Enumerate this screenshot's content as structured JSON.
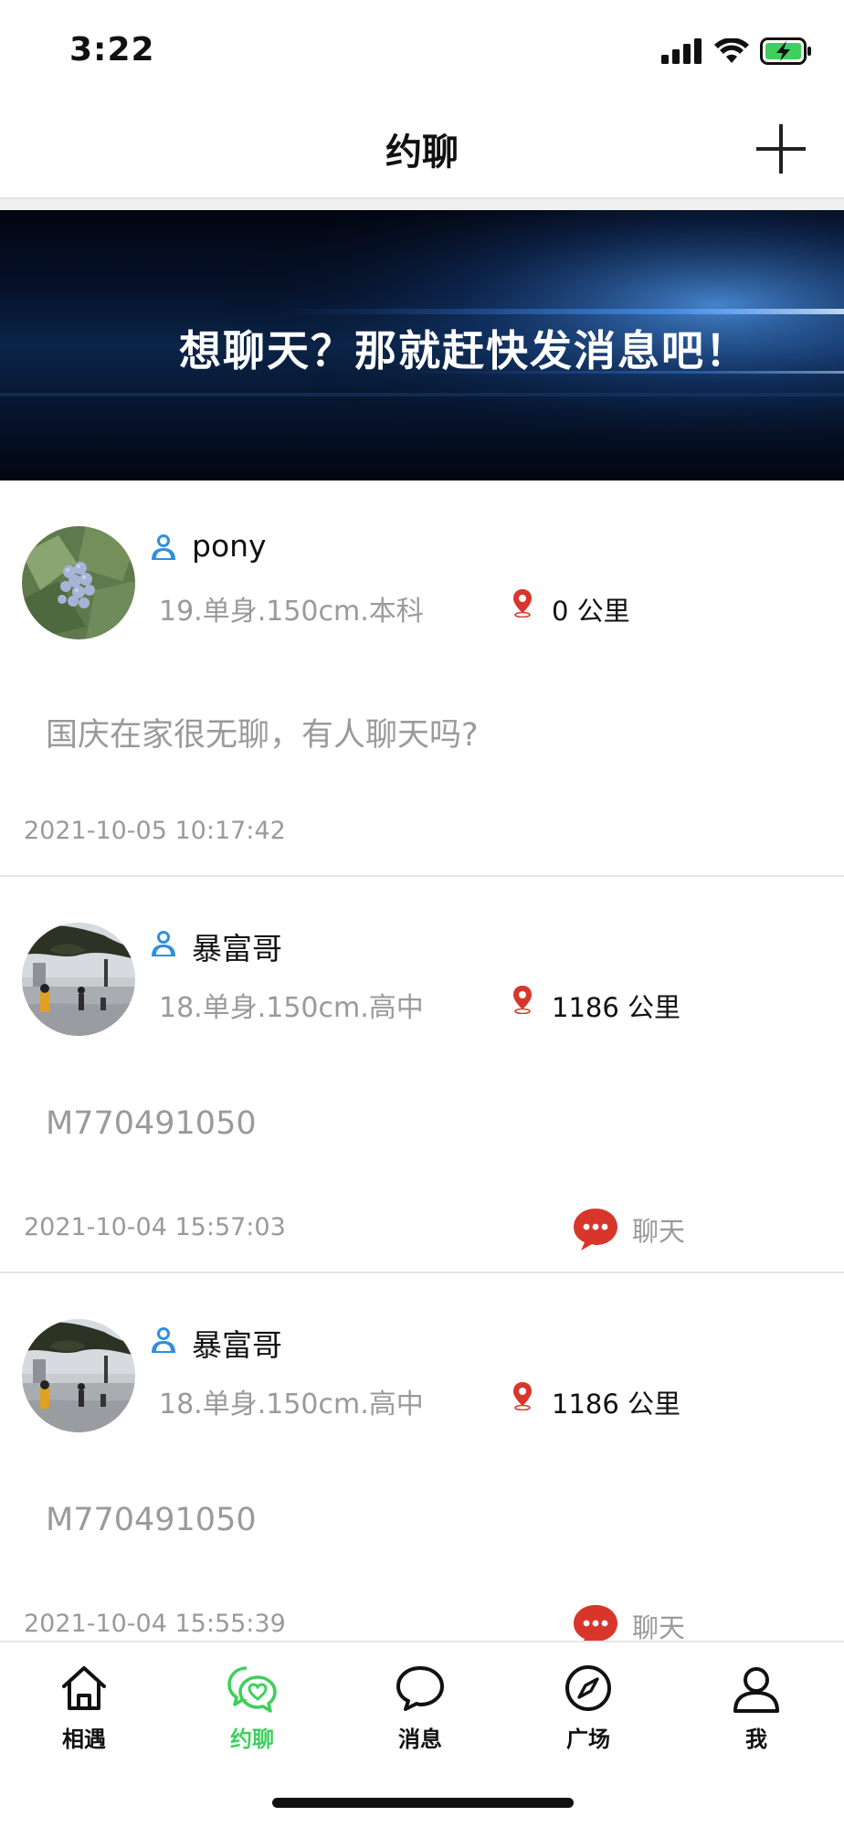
{
  "status_bar": {
    "time": "3:22"
  },
  "header": {
    "title": "约聊"
  },
  "banner": {
    "text": "想聊天？那就赶快发消息吧！"
  },
  "posts": [
    {
      "name": "pony",
      "info": "19.单身.150cm.本科",
      "distance": "0 公里",
      "content": "国庆在家很无聊，有人聊天吗?",
      "time": "2021-10-05 10:17:42",
      "chat_label": ""
    },
    {
      "name": "暴富哥",
      "info": "18.单身.150cm.高中",
      "distance": "1186 公里",
      "content": "M770491050",
      "time": "2021-10-04 15:57:03",
      "chat_label": "聊天"
    },
    {
      "name": "暴富哥",
      "info": "18.单身.150cm.高中",
      "distance": "1186 公里",
      "content": "M770491050",
      "time": "2021-10-04 15:55:39",
      "chat_label": "聊天"
    }
  ],
  "tabs": [
    {
      "label": "相遇",
      "icon": "home-icon"
    },
    {
      "label": "约聊",
      "icon": "heart-chat-icon",
      "active": true
    },
    {
      "label": "消息",
      "icon": "message-icon"
    },
    {
      "label": "广场",
      "icon": "compass-icon"
    },
    {
      "label": "我",
      "icon": "profile-icon"
    }
  ],
  "colors": {
    "accent_green": "#3fcf5d",
    "chat_red": "#d9362b",
    "user_icon_blue": "#2f8fe0",
    "location_red": "#d9362b"
  }
}
